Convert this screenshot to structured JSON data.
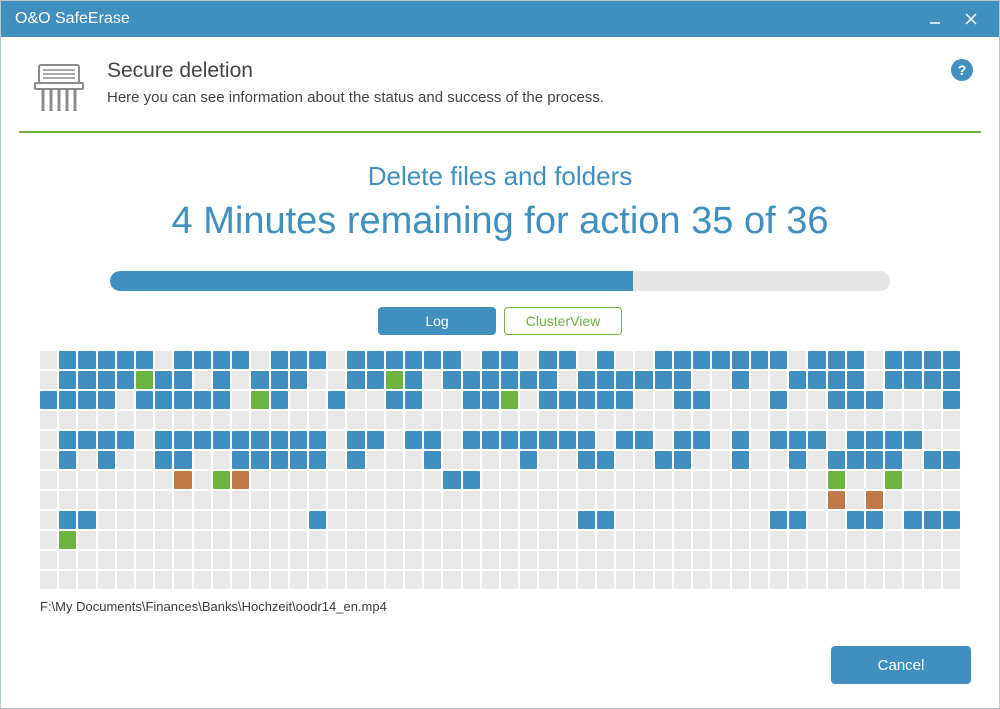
{
  "window": {
    "title": "O&O SafeErase"
  },
  "header": {
    "title": "Secure deletion",
    "subtitle": "Here you can see information about the status and success of the process."
  },
  "progress": {
    "task_title": "Delete files and folders",
    "remaining_text": "4 Minutes remaining for action 35 of 36",
    "percent": 67,
    "tabs": {
      "log": "Log",
      "cluster": "ClusterView",
      "active": "cluster"
    }
  },
  "cluster": {
    "cols": 48,
    "rows": 12,
    "legend": {
      "e": "empty",
      "b": "data",
      "g": "ok",
      "o": "warn"
    },
    "map": [
      "ebbbbbebbbbebbbebbbbbbebbebbebeebbbbbbbebbbebbbb",
      "ebbbbgbbebebbbeebbgbebbbbbbebbbbbbeebeebbbbebbbb",
      "bbbbebbbbbegbeebeebbeebbgebbbbbeebbeeebeebbbeeeb",
      "eeeeeeeeeeeeeeeeeeeeeeeeeeeeeeeeeeeeeeeeeeeeeeee",
      "ebbbbebbbbbbbbbebbebbebbbbbbbebbebbebebbbebbbbee",
      "ebebeebbeebbbbbebeeebeeeebeebbeebbeebeebebbbbebb",
      "eeeeeeeoegoeeeeeeeeeebbeeeeeeeeeeeeeeeeeegeegeee",
      "eeeeeeeeeeeeeeeeeeeeeeeeeeeeeeeeeeeeeeeeeoeoeeee",
      "ebbeeeeeeeeeeebeeeeeeeeeeeeebbeeeeeeeebbeebbebbb",
      "egeeeeeeeeeeeeeeeeeeeeeeeeeeeeeeeeeeeeeeeeeeeeee",
      "eeeeeeeeeeeeeeeeeeeeeeeeeeeeeeeeeeeeeeeeeeeeeeee",
      "eeeeeeeeeeeeeeeeeeeeeeeeeeeeeeeeeeeeeeeeeeeeeeee"
    ]
  },
  "current_path": "F:\\My Documents\\Finances\\Banks\\Hochzeit\\oodr14_en.mp4",
  "footer": {
    "cancel": "Cancel"
  }
}
